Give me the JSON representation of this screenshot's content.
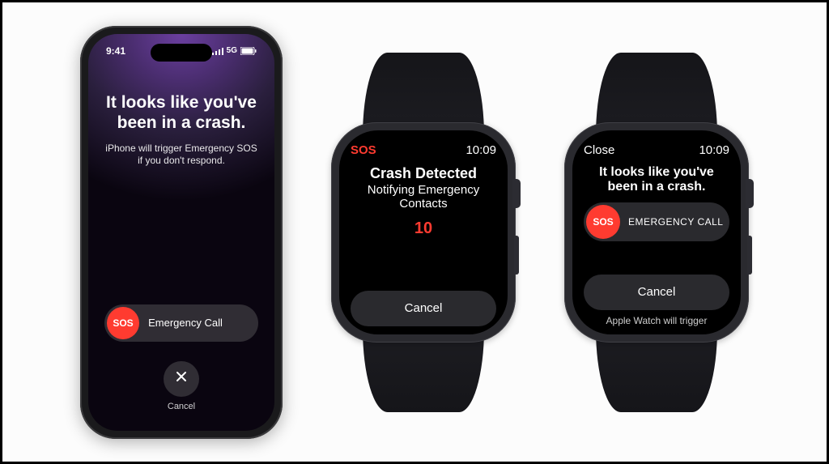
{
  "iphone": {
    "status": {
      "time": "9:41",
      "network": "5G"
    },
    "title": "It looks like you've been in a crash.",
    "subtitle": "iPhone will trigger Emergency SOS if you don't respond.",
    "sos_badge": "SOS",
    "slider_label": "Emergency Call",
    "cancel_label": "Cancel"
  },
  "watch1": {
    "header_left": "SOS",
    "header_time": "10:09",
    "title": "Crash Detected",
    "subtitle": "Notifying Emergency Contacts",
    "countdown": "10",
    "cancel_label": "Cancel"
  },
  "watch2": {
    "header_left": "Close",
    "header_time": "10:09",
    "title": "It looks like you've been in a crash.",
    "sos_badge": "SOS",
    "call_label": "EMERGENCY CALL",
    "cancel_label": "Cancel",
    "footer": "Apple Watch will trigger"
  },
  "colors": {
    "sos_red": "#ff3b30"
  }
}
